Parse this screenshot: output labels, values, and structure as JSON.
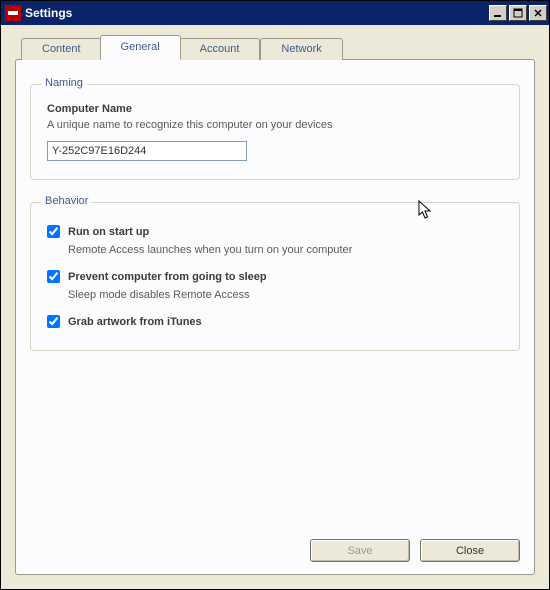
{
  "window": {
    "title": "Settings"
  },
  "tabs": {
    "content": "Content",
    "general": "General",
    "account": "Account",
    "network": "Network",
    "active": "general"
  },
  "naming": {
    "group_label": "Naming",
    "heading": "Computer Name",
    "description": "A unique name to recognize this computer on your devices",
    "value": "Y-252C97E16D244"
  },
  "behavior": {
    "group_label": "Behavior",
    "startup": {
      "label": "Run on start up",
      "description": "Remote Access launches when you turn on your computer",
      "checked": true
    },
    "sleep": {
      "label": "Prevent computer from going to sleep",
      "description": "Sleep mode disables Remote Access",
      "checked": true
    },
    "artwork": {
      "label": "Grab artwork from iTunes",
      "checked": true
    }
  },
  "buttons": {
    "save": "Save",
    "close": "Close",
    "save_enabled": false
  }
}
